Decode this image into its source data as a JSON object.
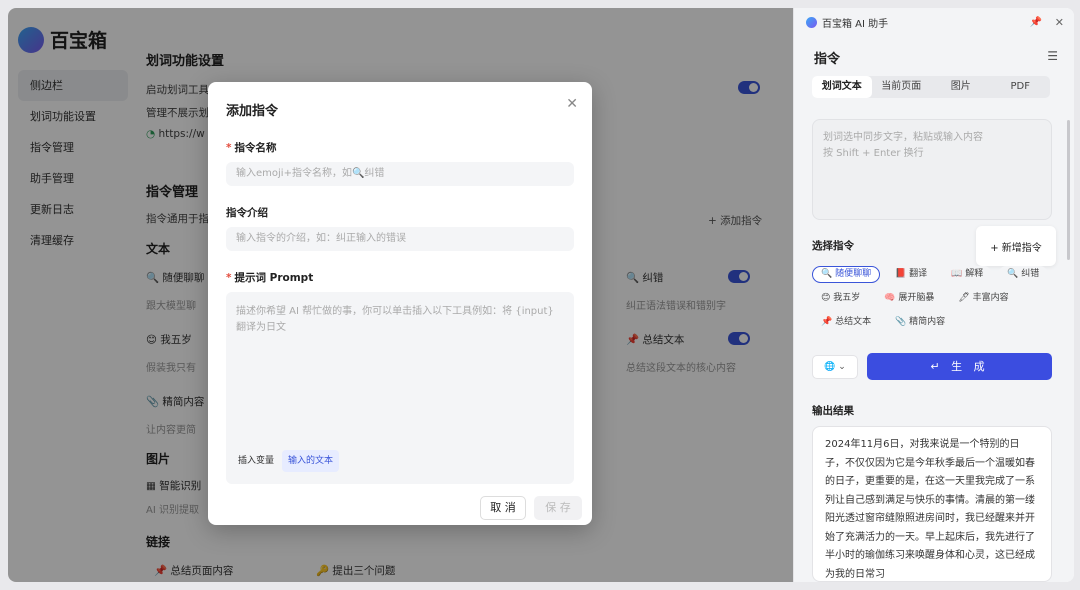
{
  "app": {
    "logo_text": "百宝箱"
  },
  "sidebar": {
    "items": [
      {
        "label": "侧边栏"
      },
      {
        "label": "划词功能设置"
      },
      {
        "label": "指令管理"
      },
      {
        "label": "助手管理"
      },
      {
        "label": "更新日志"
      },
      {
        "label": "清理缓存"
      }
    ]
  },
  "settings": {
    "hword_title": "划词功能设置",
    "enable_label": "启动划词工具",
    "exclude_label": "管理不展示划",
    "site_url": "https://w",
    "cmd_title": "指令管理",
    "cmd_desc": "指令通用于指",
    "add_cmd": "+ 添加指令",
    "text_group": "文本",
    "image_group": "图片",
    "link_group": "链接",
    "cards": [
      {
        "name": "随便聊聊",
        "desc": "跟大模型聊",
        "icon": "🔍"
      },
      {
        "name": "纠错",
        "desc": "纠正语法错误和错别字",
        "icon": "🔍"
      },
      {
        "name": "我五岁",
        "desc": "假装我只有",
        "icon": "😊"
      },
      {
        "name": "总结文本",
        "desc": "总结这段文本的核心内容",
        "icon": "📌"
      },
      {
        "name": "精简内容",
        "desc": "让内容更简",
        "icon": "📎"
      },
      {
        "name": "智能识别",
        "desc": "AI 识别提取",
        "icon": "▦"
      },
      {
        "name": "总结页面内容",
        "icon": "📌"
      },
      {
        "name": "提出三个问题",
        "icon": "🔑"
      }
    ]
  },
  "modal": {
    "title": "添加指令",
    "name_label": "指令名称",
    "name_placeholder": "输入emoji+指令名称，如🔍纠错",
    "intro_label": "指令介绍",
    "intro_placeholder": "输入指令的介绍，如：纠正输入的错误",
    "prompt_label": "提示词 Prompt",
    "prompt_placeholder": "描述你希望 AI 帮忙做的事，你可以单击插入以下工具例如：将 {input} 翻译为日文",
    "insert_label": "插入变量",
    "insert_chip": "输入的文本",
    "cancel": "取 消",
    "save": "保 存"
  },
  "panel": {
    "window_title": "百宝箱 AI 助手",
    "title": "指令",
    "tabs": [
      {
        "label": "划词文本"
      },
      {
        "label": "当前页面"
      },
      {
        "label": "图片"
      },
      {
        "label": "PDF"
      }
    ],
    "input_placeholder_1": "划词选中同步文字，粘贴或输入内容",
    "input_placeholder_2": "按 Shift + Enter 换行",
    "select_label": "选择指令",
    "new_cmd": "+ 新增指令",
    "chips": [
      {
        "label": "🔍 随便聊聊"
      },
      {
        "label": "📕 翻译"
      },
      {
        "label": "📖 解释"
      },
      {
        "label": "🔍 纠错"
      },
      {
        "label": "😊 我五岁"
      },
      {
        "label": "🧠 展开脑暴"
      },
      {
        "label": "🖊 丰富内容"
      },
      {
        "label": "📌 总结文本"
      },
      {
        "label": "📎 精简内容"
      }
    ],
    "model_btn": "🌐 ⌄",
    "generate": "↵ 生 成",
    "output_label": "输出结果",
    "output_text": "2024年11月6日，对我来说是一个特别的日子，不仅仅因为它是今年秋季最后一个温暖如春的日子，更重要的是，在这一天里我完成了一系列让自己感到满足与快乐的事情。清晨的第一缕阳光透过窗帘缝隙照进房间时，我已经醒来并开始了充满活力的一天。早上起床后，我先进行了半小时的瑜伽练习来唤醒身体和心灵，这已经成为我的日常习"
  },
  "colors": {
    "accent": "#3b4de0",
    "required": "#e34b3d",
    "toggle_on": "#3a55d9"
  }
}
